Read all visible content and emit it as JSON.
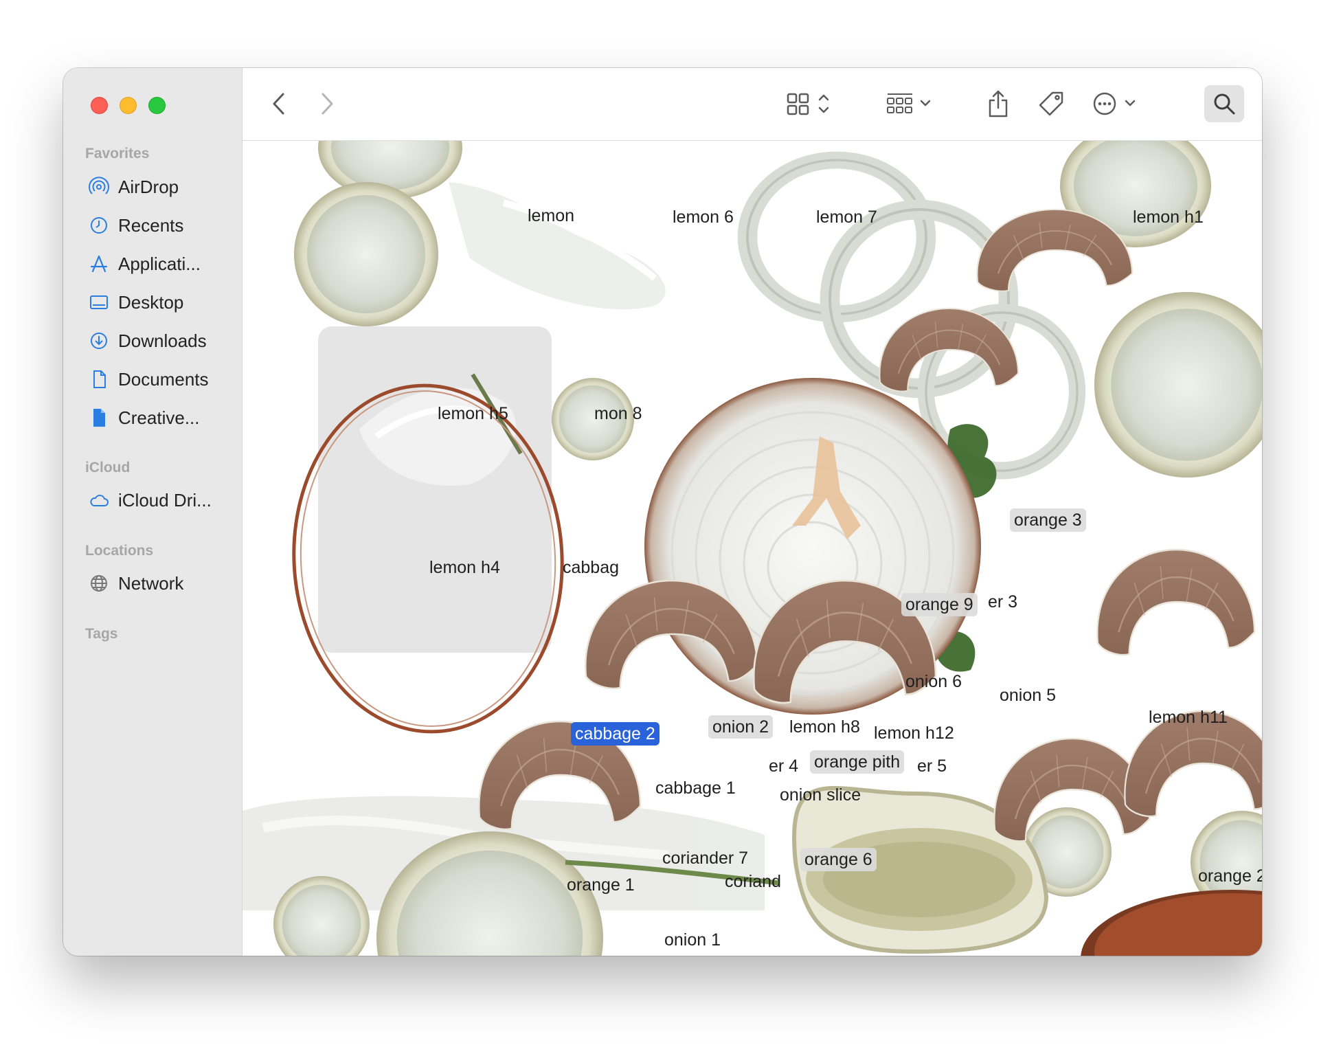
{
  "sidebar": {
    "favorites_label": "Favorites",
    "favorites": [
      {
        "label": "AirDrop",
        "icon": "airdrop-icon"
      },
      {
        "label": "Recents",
        "icon": "clock-icon"
      },
      {
        "label": "Applicati...",
        "icon": "applications-icon"
      },
      {
        "label": "Desktop",
        "icon": "desktop-icon"
      },
      {
        "label": "Downloads",
        "icon": "download-icon"
      },
      {
        "label": "Documents",
        "icon": "document-icon"
      },
      {
        "label": "Creative...",
        "icon": "file-icon"
      }
    ],
    "icloud_label": "iCloud",
    "icloud": [
      {
        "label": "iCloud Dri...",
        "icon": "cloud-icon"
      }
    ],
    "locations_label": "Locations",
    "locations": [
      {
        "label": "Network",
        "icon": "globe-icon"
      }
    ],
    "tags_label": "Tags"
  },
  "toolbar": {
    "back": "chevron-left-icon",
    "forward": "chevron-right-icon",
    "view": "icon-grid-icon",
    "group": "group-icon",
    "share": "share-icon",
    "tag": "tag-icon",
    "more": "ellipsis-circle-icon",
    "search": "search-icon"
  },
  "files": [
    {
      "label": "lemon",
      "style": "plain"
    },
    {
      "label": "lemon 6",
      "style": "plain"
    },
    {
      "label": "lemon 7",
      "style": "plain"
    },
    {
      "label": "lemon h1",
      "style": "plain"
    },
    {
      "label": "lemon h5",
      "style": "plain"
    },
    {
      "label": "mon 8",
      "style": "plain"
    },
    {
      "label": "lemon h4",
      "style": "plain"
    },
    {
      "label": "cabbag",
      "style": "plain"
    },
    {
      "label": "orange 3",
      "style": "boxed"
    },
    {
      "label": "orange 9",
      "style": "boxed"
    },
    {
      "label": "er 3",
      "style": "plain"
    },
    {
      "label": "onion 6",
      "style": "plain"
    },
    {
      "label": "onion 5",
      "style": "plain"
    },
    {
      "label": "lemon h11",
      "style": "plain"
    },
    {
      "label": "cabbage 2",
      "style": "selected"
    },
    {
      "label": "onion 2",
      "style": "boxed"
    },
    {
      "label": "lemon h8",
      "style": "plain"
    },
    {
      "label": "lemon h12",
      "style": "plain"
    },
    {
      "label": "er 4",
      "style": "plain"
    },
    {
      "label": "orange pith",
      "style": "boxed"
    },
    {
      "label": "er 5",
      "style": "plain"
    },
    {
      "label": "cabbage 1",
      "style": "plain"
    },
    {
      "label": "onion slice",
      "style": "plain"
    },
    {
      "label": "coriander 7",
      "style": "plain"
    },
    {
      "label": "orange 6",
      "style": "boxed"
    },
    {
      "label": "orange 1",
      "style": "plain"
    },
    {
      "label": "coriand",
      "style": "plain"
    },
    {
      "label": "orange 2",
      "style": "plain"
    },
    {
      "label": "onion 1",
      "style": "plain"
    }
  ],
  "colors": {
    "selection": "#2a62d9",
    "sidebar_bg": "#e8e8e8",
    "accent_icon": "#2a7de1"
  }
}
